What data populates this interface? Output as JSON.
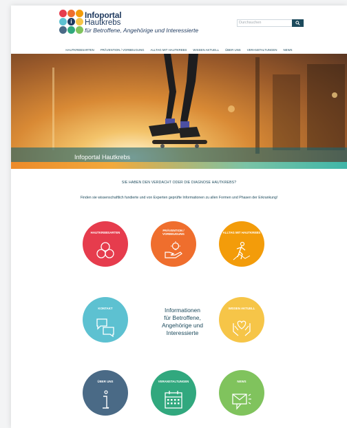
{
  "header": {
    "logo": {
      "line1": "Infoportal",
      "line2": "Hautkrebs",
      "line3": "für Betroffene, Angehörige und Interessierte"
    },
    "search": {
      "placeholder": "Durchsuchen",
      "button_icon": "search-icon"
    }
  },
  "nav": {
    "items": [
      {
        "label": "HAUTKREBSARTEN"
      },
      {
        "label": "PRÄVENTION / VORBEUGUNG"
      },
      {
        "label": "ALLTAG MIT HAUTKREBS"
      },
      {
        "label": "WISSEN AKTUELL"
      },
      {
        "label": "ÜBER UNS"
      },
      {
        "label": "VERANSTALTUNGEN"
      },
      {
        "label": "NEWS"
      }
    ]
  },
  "hero": {
    "title": "Infoportal Hautkrebs"
  },
  "intro": {
    "heading": "SIE HABEN DEN VERDACHT ODER DIE DIAGNOSE HAUTKREBS?",
    "text": "Finden sie wissenschaftlich fundierte und von Experten geprüfte Informationen zu allen Formen und Phasen der Erkrankung!"
  },
  "tiles": [
    {
      "label": "HAUTKREBSARTEN",
      "icon": "cells-icon",
      "color": "#e63c4d"
    },
    {
      "label": "PRÄVENTION / VORBEUGUNG",
      "icon": "lightbulb-hand-icon",
      "color": "#ef6e2d"
    },
    {
      "label": "ALLTAG MIT HAUTKREBS",
      "icon": "hiker-icon",
      "color": "#f39c0a"
    },
    {
      "label": "KONTAKT",
      "icon": "chat-bubbles-icon",
      "color": "#5dc1d1"
    },
    {
      "label": "WISSEN AKTUELL",
      "icon": "heart-hands-icon",
      "color": "#f6c548"
    },
    {
      "label": "ÜBER UNS",
      "icon": "info-icon",
      "color": "#4a6a86"
    },
    {
      "label": "VERANSTALTUNGEN",
      "icon": "calendar-icon",
      "color": "#31a87e"
    },
    {
      "label": "NEWS",
      "icon": "megaphone-icon",
      "color": "#80c35d"
    }
  ],
  "center_text": {
    "lines": [
      "Informationen",
      "für Betroffene,",
      "Angehörige und",
      "Interessierte"
    ]
  }
}
